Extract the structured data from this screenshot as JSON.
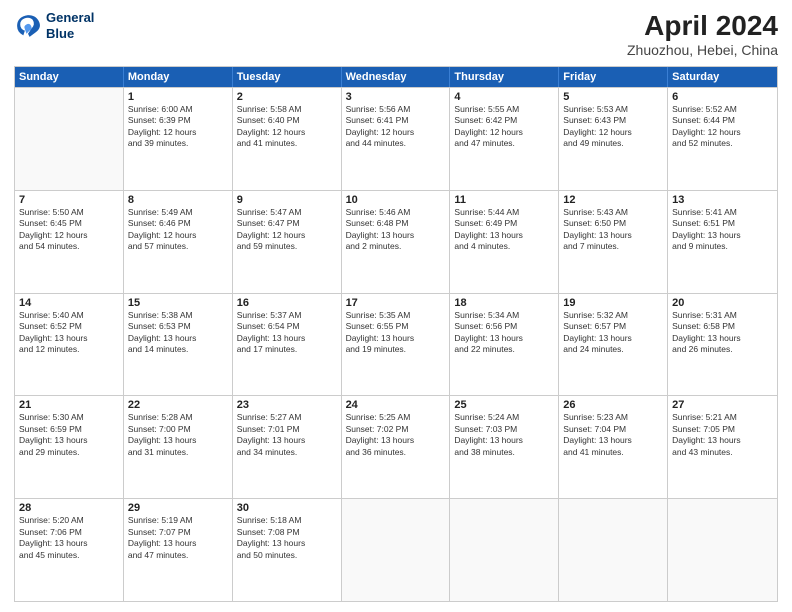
{
  "header": {
    "logo_line1": "General",
    "logo_line2": "Blue",
    "title": "April 2024",
    "subtitle": "Zhuozhou, Hebei, China"
  },
  "weekdays": [
    "Sunday",
    "Monday",
    "Tuesday",
    "Wednesday",
    "Thursday",
    "Friday",
    "Saturday"
  ],
  "weeks": [
    [
      {
        "day": "",
        "lines": []
      },
      {
        "day": "1",
        "lines": [
          "Sunrise: 6:00 AM",
          "Sunset: 6:39 PM",
          "Daylight: 12 hours",
          "and 39 minutes."
        ]
      },
      {
        "day": "2",
        "lines": [
          "Sunrise: 5:58 AM",
          "Sunset: 6:40 PM",
          "Daylight: 12 hours",
          "and 41 minutes."
        ]
      },
      {
        "day": "3",
        "lines": [
          "Sunrise: 5:56 AM",
          "Sunset: 6:41 PM",
          "Daylight: 12 hours",
          "and 44 minutes."
        ]
      },
      {
        "day": "4",
        "lines": [
          "Sunrise: 5:55 AM",
          "Sunset: 6:42 PM",
          "Daylight: 12 hours",
          "and 47 minutes."
        ]
      },
      {
        "day": "5",
        "lines": [
          "Sunrise: 5:53 AM",
          "Sunset: 6:43 PM",
          "Daylight: 12 hours",
          "and 49 minutes."
        ]
      },
      {
        "day": "6",
        "lines": [
          "Sunrise: 5:52 AM",
          "Sunset: 6:44 PM",
          "Daylight: 12 hours",
          "and 52 minutes."
        ]
      }
    ],
    [
      {
        "day": "7",
        "lines": [
          "Sunrise: 5:50 AM",
          "Sunset: 6:45 PM",
          "Daylight: 12 hours",
          "and 54 minutes."
        ]
      },
      {
        "day": "8",
        "lines": [
          "Sunrise: 5:49 AM",
          "Sunset: 6:46 PM",
          "Daylight: 12 hours",
          "and 57 minutes."
        ]
      },
      {
        "day": "9",
        "lines": [
          "Sunrise: 5:47 AM",
          "Sunset: 6:47 PM",
          "Daylight: 12 hours",
          "and 59 minutes."
        ]
      },
      {
        "day": "10",
        "lines": [
          "Sunrise: 5:46 AM",
          "Sunset: 6:48 PM",
          "Daylight: 13 hours",
          "and 2 minutes."
        ]
      },
      {
        "day": "11",
        "lines": [
          "Sunrise: 5:44 AM",
          "Sunset: 6:49 PM",
          "Daylight: 13 hours",
          "and 4 minutes."
        ]
      },
      {
        "day": "12",
        "lines": [
          "Sunrise: 5:43 AM",
          "Sunset: 6:50 PM",
          "Daylight: 13 hours",
          "and 7 minutes."
        ]
      },
      {
        "day": "13",
        "lines": [
          "Sunrise: 5:41 AM",
          "Sunset: 6:51 PM",
          "Daylight: 13 hours",
          "and 9 minutes."
        ]
      }
    ],
    [
      {
        "day": "14",
        "lines": [
          "Sunrise: 5:40 AM",
          "Sunset: 6:52 PM",
          "Daylight: 13 hours",
          "and 12 minutes."
        ]
      },
      {
        "day": "15",
        "lines": [
          "Sunrise: 5:38 AM",
          "Sunset: 6:53 PM",
          "Daylight: 13 hours",
          "and 14 minutes."
        ]
      },
      {
        "day": "16",
        "lines": [
          "Sunrise: 5:37 AM",
          "Sunset: 6:54 PM",
          "Daylight: 13 hours",
          "and 17 minutes."
        ]
      },
      {
        "day": "17",
        "lines": [
          "Sunrise: 5:35 AM",
          "Sunset: 6:55 PM",
          "Daylight: 13 hours",
          "and 19 minutes."
        ]
      },
      {
        "day": "18",
        "lines": [
          "Sunrise: 5:34 AM",
          "Sunset: 6:56 PM",
          "Daylight: 13 hours",
          "and 22 minutes."
        ]
      },
      {
        "day": "19",
        "lines": [
          "Sunrise: 5:32 AM",
          "Sunset: 6:57 PM",
          "Daylight: 13 hours",
          "and 24 minutes."
        ]
      },
      {
        "day": "20",
        "lines": [
          "Sunrise: 5:31 AM",
          "Sunset: 6:58 PM",
          "Daylight: 13 hours",
          "and 26 minutes."
        ]
      }
    ],
    [
      {
        "day": "21",
        "lines": [
          "Sunrise: 5:30 AM",
          "Sunset: 6:59 PM",
          "Daylight: 13 hours",
          "and 29 minutes."
        ]
      },
      {
        "day": "22",
        "lines": [
          "Sunrise: 5:28 AM",
          "Sunset: 7:00 PM",
          "Daylight: 13 hours",
          "and 31 minutes."
        ]
      },
      {
        "day": "23",
        "lines": [
          "Sunrise: 5:27 AM",
          "Sunset: 7:01 PM",
          "Daylight: 13 hours",
          "and 34 minutes."
        ]
      },
      {
        "day": "24",
        "lines": [
          "Sunrise: 5:25 AM",
          "Sunset: 7:02 PM",
          "Daylight: 13 hours",
          "and 36 minutes."
        ]
      },
      {
        "day": "25",
        "lines": [
          "Sunrise: 5:24 AM",
          "Sunset: 7:03 PM",
          "Daylight: 13 hours",
          "and 38 minutes."
        ]
      },
      {
        "day": "26",
        "lines": [
          "Sunrise: 5:23 AM",
          "Sunset: 7:04 PM",
          "Daylight: 13 hours",
          "and 41 minutes."
        ]
      },
      {
        "day": "27",
        "lines": [
          "Sunrise: 5:21 AM",
          "Sunset: 7:05 PM",
          "Daylight: 13 hours",
          "and 43 minutes."
        ]
      }
    ],
    [
      {
        "day": "28",
        "lines": [
          "Sunrise: 5:20 AM",
          "Sunset: 7:06 PM",
          "Daylight: 13 hours",
          "and 45 minutes."
        ]
      },
      {
        "day": "29",
        "lines": [
          "Sunrise: 5:19 AM",
          "Sunset: 7:07 PM",
          "Daylight: 13 hours",
          "and 47 minutes."
        ]
      },
      {
        "day": "30",
        "lines": [
          "Sunrise: 5:18 AM",
          "Sunset: 7:08 PM",
          "Daylight: 13 hours",
          "and 50 minutes."
        ]
      },
      {
        "day": "",
        "lines": []
      },
      {
        "day": "",
        "lines": []
      },
      {
        "day": "",
        "lines": []
      },
      {
        "day": "",
        "lines": []
      }
    ]
  ]
}
